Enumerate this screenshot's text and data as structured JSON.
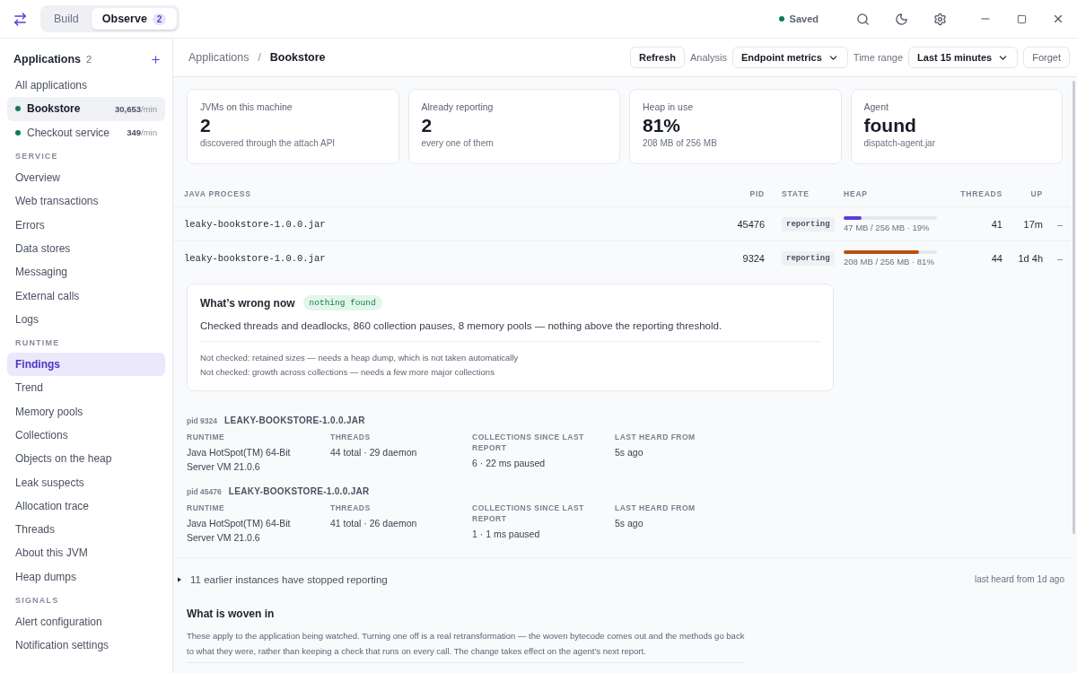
{
  "mode_tabs": [
    {
      "label": "Build",
      "selected": false
    },
    {
      "label": "Observe",
      "selected": true,
      "badge": "2"
    }
  ],
  "status": {
    "label": "Saved",
    "color": "#0f7a55"
  },
  "sidebar": {
    "title": "Applications",
    "count": "2",
    "all_label": "All applications",
    "apps": [
      {
        "name": "Bookstore",
        "rate": "30,653",
        "unit": "/min",
        "selected": true,
        "color": "#0f7a55"
      },
      {
        "name": "Checkout service",
        "rate": "349",
        "unit": "/min",
        "selected": false,
        "color": "#0f7a55"
      }
    ],
    "sections": [
      {
        "heading": "SERVICE",
        "items": [
          {
            "label": "Overview",
            "selected": false
          },
          {
            "label": "Web transactions",
            "selected": false
          },
          {
            "label": "Errors",
            "selected": false
          },
          {
            "label": "Data stores",
            "selected": false
          },
          {
            "label": "Messaging",
            "selected": false
          },
          {
            "label": "External calls",
            "selected": false
          },
          {
            "label": "Logs",
            "selected": false
          }
        ]
      },
      {
        "heading": "RUNTIME",
        "items": [
          {
            "label": "Findings",
            "selected": true
          },
          {
            "label": "Trend",
            "selected": false
          },
          {
            "label": "Memory pools",
            "selected": false
          },
          {
            "label": "Collections",
            "selected": false
          },
          {
            "label": "Objects on the heap",
            "selected": false
          },
          {
            "label": "Leak suspects",
            "selected": false
          },
          {
            "label": "Allocation trace",
            "selected": false
          },
          {
            "label": "Threads",
            "selected": false
          },
          {
            "label": "About this JVM",
            "selected": false
          },
          {
            "label": "Heap dumps",
            "selected": false
          }
        ]
      },
      {
        "heading": "SIGNALS",
        "items": [
          {
            "label": "Alert configuration",
            "selected": false
          },
          {
            "label": "Notification settings",
            "selected": false
          }
        ]
      }
    ]
  },
  "breadcrumb": [
    "Applications",
    "Bookstore"
  ],
  "breadcrumb_separator": "/",
  "toolbar": {
    "refresh": "Refresh",
    "analysis_label": "Analysis",
    "analysis_value": "Endpoint metrics",
    "time_label": "Time range",
    "time_value": "Last 15 minutes",
    "forget": "Forget"
  },
  "stats": [
    {
      "label": "JVMs on this machine",
      "value": "2",
      "note": "discovered through the attach API"
    },
    {
      "label": "Already reporting",
      "value": "2",
      "note": "every one of them"
    },
    {
      "label": "Heap in use",
      "value": "81%",
      "note": "208 MB of 256 MB"
    },
    {
      "label": "Agent",
      "value": "found",
      "note": "dispatch-agent.jar"
    }
  ],
  "process_table": {
    "columns": [
      "JAVA PROCESS",
      "PID",
      "STATE",
      "HEAP",
      "THREADS",
      "UP"
    ],
    "rows": [
      {
        "name": "leaky-bookstore-1.0.0.jar",
        "pid": "45476",
        "state": "reporting",
        "level": 0.19,
        "color": "#5b3fd6",
        "heap": "47 MB / 256 MB · 19%",
        "threads": "41",
        "up": "17m",
        "action": "–"
      },
      {
        "name": "leaky-bookstore-1.0.0.jar",
        "pid": "9324",
        "state": "reporting",
        "level": 0.81,
        "color": "#b4530f",
        "heap": "208 MB / 256 MB · 81%",
        "threads": "44",
        "up": "1d 4h",
        "action": "–"
      }
    ]
  },
  "findings": {
    "title": "What’s wrong now",
    "badge": "nothing found",
    "summary": "Checked threads and deadlocks, 860 collection pauses, 8 memory pools — nothing above the reporting threshold.",
    "not_checked": [
      "Not checked: retained sizes — needs a heap dump, which is not taken automatically",
      "Not checked: growth across collections — needs a few more major collections"
    ]
  },
  "details": [
    {
      "pid": "pid 9324",
      "name": "LEAKY-BOOKSTORE-1.0.0.JAR",
      "fields": [
        {
          "label": "RUNTIME",
          "value": "Java HotSpot(TM) 64-Bit Server VM 21.0.6"
        },
        {
          "label": "THREADS",
          "value": "44 total · 29 daemon"
        },
        {
          "label": "COLLECTIONS SINCE LAST REPORT",
          "value": "6 · 22 ms paused"
        },
        {
          "label": "LAST HEARD FROM",
          "value": "5s ago"
        }
      ]
    },
    {
      "pid": "pid 45476",
      "name": "LEAKY-BOOKSTORE-1.0.0.JAR",
      "fields": [
        {
          "label": "RUNTIME",
          "value": "Java HotSpot(TM) 64-Bit Server VM 21.0.6"
        },
        {
          "label": "THREADS",
          "value": "41 total · 26 daemon"
        },
        {
          "label": "COLLECTIONS SINCE LAST REPORT",
          "value": "1 · 1 ms paused"
        },
        {
          "label": "LAST HEARD FROM",
          "value": "5s ago"
        }
      ]
    }
  ],
  "earlier": {
    "label": "11 earlier instances have stopped reporting",
    "last_heard": "last heard from 1d ago",
    "expanded": false
  },
  "woven": {
    "title": "What is woven in",
    "text": "These apply to the application being watched. Turning one off is a real retransformation — the woven bytecode comes out and the methods go back to what they were, rather than keeping a check that runs on every call. The change takes effect on the agent’s next report."
  }
}
